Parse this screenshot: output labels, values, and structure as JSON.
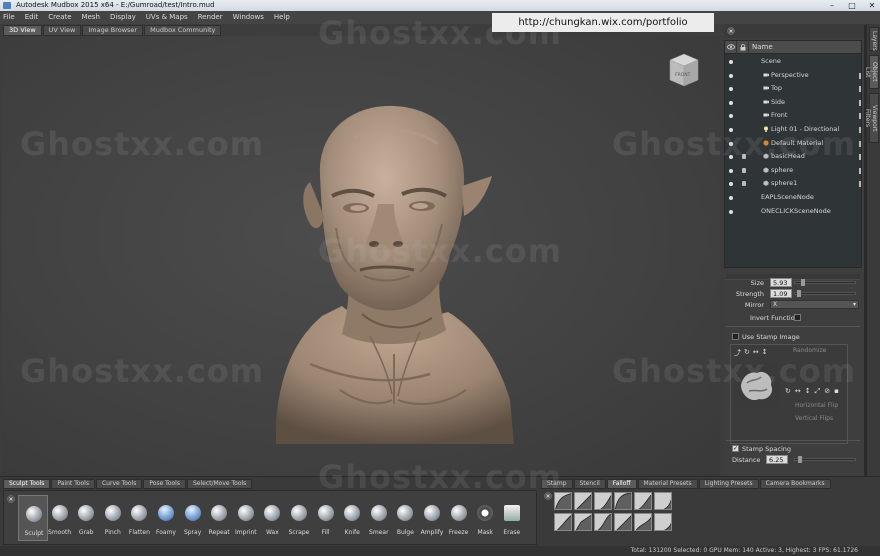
{
  "window": {
    "title": "Autodesk Mudbox 2015 x64 - E:/Gumroad/test/Intro.mud",
    "buttons": [
      "–",
      "□",
      "✕"
    ]
  },
  "menu": [
    "File",
    "Edit",
    "Create",
    "Mesh",
    "Display",
    "UVs & Maps",
    "Render",
    "Windows",
    "Help"
  ],
  "overlay_url": "http://chungkan.wix.com/portfolio",
  "watermark": "Ghostxx.com",
  "view_tabs": [
    {
      "label": "3D View",
      "active": true
    },
    {
      "label": "UV View",
      "active": false
    },
    {
      "label": "Image Browser",
      "active": false
    },
    {
      "label": "Mudbox Community",
      "active": false
    }
  ],
  "viewcube_label": "FRONT",
  "side_tabs": [
    "Layers",
    "Object List",
    "Viewport Filters"
  ],
  "outliner": {
    "header": "Name",
    "rows": [
      {
        "label": "Scene",
        "indent": 0,
        "icon": "none"
      },
      {
        "label": "Perspective",
        "indent": 1,
        "icon": "camera-icon"
      },
      {
        "label": "Top",
        "indent": 1,
        "icon": "camera-icon"
      },
      {
        "label": "Side",
        "indent": 1,
        "icon": "camera-icon"
      },
      {
        "label": "Front",
        "indent": 1,
        "icon": "camera-icon"
      },
      {
        "label": "Light 01 - Directional",
        "indent": 1,
        "icon": "light-icon"
      },
      {
        "label": "Default Material",
        "indent": 1,
        "icon": "material-icon"
      },
      {
        "label": "basicHead",
        "indent": 1,
        "icon": "mesh-icon"
      },
      {
        "label": "sphere",
        "indent": 1,
        "icon": "mesh-icon"
      },
      {
        "label": "sphere1",
        "indent": 1,
        "icon": "mesh-icon"
      },
      {
        "label": "EAPLSceneNode",
        "indent": 0,
        "icon": "none"
      },
      {
        "label": "ONECLICKSceneNode",
        "indent": 0,
        "icon": "none"
      }
    ]
  },
  "properties": {
    "size_label": "Size",
    "size_value": "5.93",
    "strength_label": "Strength",
    "strength_value": "1.09",
    "mirror_label": "Mirror",
    "mirror_value": "X",
    "invert_label": "Invert Function",
    "use_stamp_label": "Use Stamp Image",
    "randomize_label": "Randomize",
    "hflip_label": "Horizontal Flip",
    "vflip_label": "Vertical Flips",
    "stamp_spacing_label": "Stamp Spacing",
    "distance_label": "Distance",
    "distance_value": "6.25"
  },
  "tool_tabs": [
    {
      "label": "Sculpt Tools",
      "active": true
    },
    {
      "label": "Paint Tools",
      "active": false
    },
    {
      "label": "Curve Tools",
      "active": false
    },
    {
      "label": "Pose Tools",
      "active": false
    },
    {
      "label": "Select/Move Tools",
      "active": false
    }
  ],
  "tools": [
    "Sculpt",
    "Smooth",
    "Grab",
    "Pinch",
    "Flatten",
    "Foamy",
    "Spray",
    "Repeat",
    "Imprint",
    "Wax",
    "Scrape",
    "Fill",
    "Knife",
    "Smear",
    "Bulge",
    "Amplify",
    "Freeze",
    "Mask",
    "Erase"
  ],
  "tray_tabs": [
    {
      "label": "Stamp",
      "active": false
    },
    {
      "label": "Stencil",
      "active": false
    },
    {
      "label": "Falloff",
      "active": true
    },
    {
      "label": "Material Presets",
      "active": false
    },
    {
      "label": "Lighting Presets",
      "active": false
    },
    {
      "label": "Camera Bookmarks",
      "active": false
    }
  ],
  "status": "Total: 131200  Selected: 0  GPU Mem: 140  Active: 3, Highest: 3  FPS: 61.1726",
  "colors": {
    "skin": "#a48e7b",
    "bg": "#3d3d3d",
    "panel": "#2f3436"
  }
}
